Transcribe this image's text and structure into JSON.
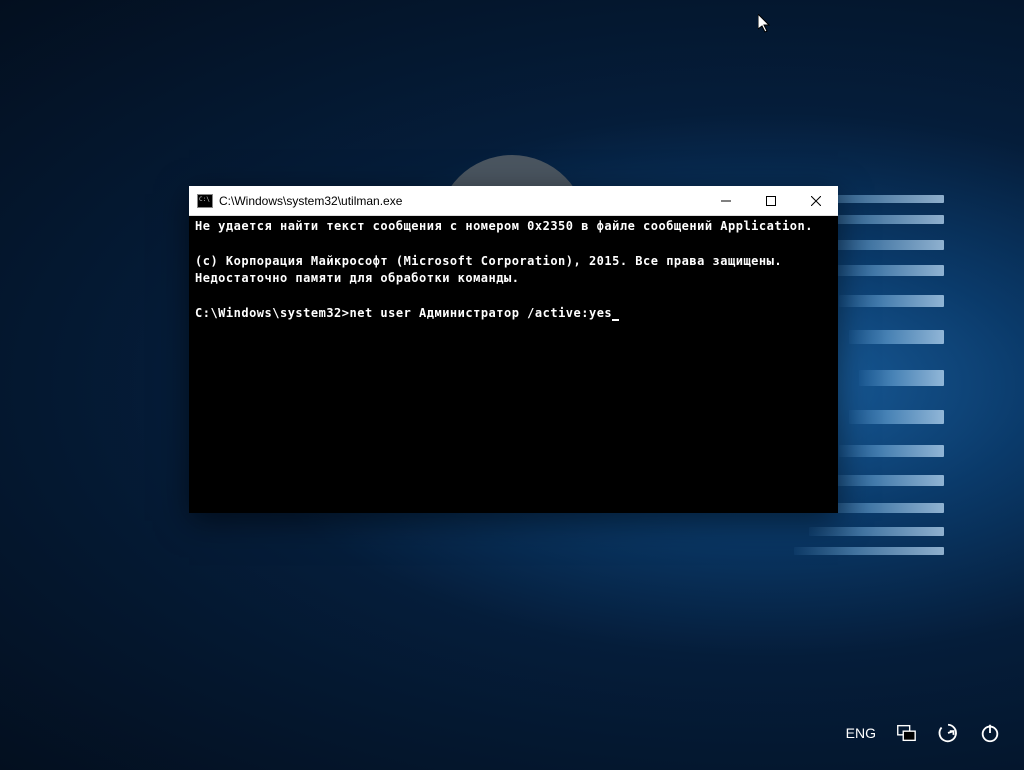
{
  "window": {
    "title": "C:\\Windows\\system32\\utilman.exe"
  },
  "terminal": {
    "line1": "Не удается найти текст сообщения с номером 0x2350 в файле сообщений Application.",
    "line2": "(c) Корпорация Майкрософт (Microsoft Corporation), 2015. Все права защищены.",
    "line3": "Недостаточно памяти для обработки команды.",
    "prompt": "C:\\Windows\\system32>",
    "command": "net user Администратор /active:yes"
  },
  "lockscreen": {
    "language": "ENG"
  }
}
